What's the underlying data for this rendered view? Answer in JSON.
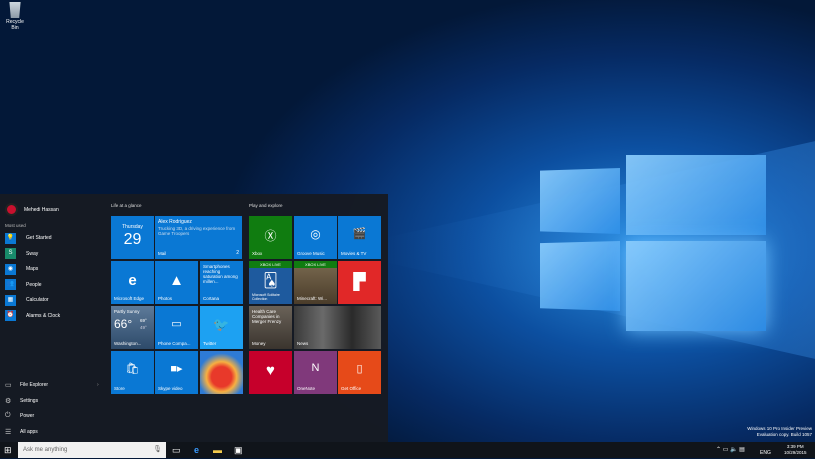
{
  "desktop": {
    "recycle_bin": "Recycle Bin",
    "watermark": [
      "Windows 10 Pro Insider Preview",
      "Evaluation copy. Build 1057"
    ]
  },
  "start": {
    "user": "Mehedi Hassan",
    "most_used_label": "Most used",
    "apps": [
      {
        "label": "Get Started",
        "icon": "lightbulb-icon",
        "color": "#0a78d4"
      },
      {
        "label": "Sway",
        "icon": "sway-icon",
        "color": "#188a6b"
      },
      {
        "label": "Maps",
        "icon": "maps-icon",
        "color": "#0a78d4"
      },
      {
        "label": "People",
        "icon": "people-icon",
        "color": "#0a78d4"
      },
      {
        "label": "Calculator",
        "icon": "calculator-icon",
        "color": "#0a78d4"
      },
      {
        "label": "Alarms & Clock",
        "icon": "alarm-icon",
        "color": "#0a78d4"
      }
    ],
    "system": [
      {
        "label": "File Explorer",
        "icon": "folder-icon"
      },
      {
        "label": "Settings",
        "icon": "gear-icon"
      },
      {
        "label": "Power",
        "icon": "power-icon"
      },
      {
        "label": "All apps",
        "icon": "list-icon"
      }
    ],
    "group1": {
      "title": "Life at a glance",
      "calendar": {
        "day": "Thursday",
        "date": "29"
      },
      "mail": {
        "from": "Alex Rodriguez",
        "body": "Trucking 3D, a driving experience from Game Troopers",
        "label": "Mail",
        "count": "2"
      },
      "edge": "Microsoft Edge",
      "photos": "Photos",
      "cortana": {
        "text": "Smartphones reaching saturation among millen...",
        "label": "Cortana"
      },
      "weather": {
        "cond": "Partly Sunny",
        "temp": "66°",
        "hi": "69°",
        "lo": "49°",
        "label": "Washington..."
      },
      "phone": "Phone Compa...",
      "twitter": "Twitter",
      "store": "Store",
      "skype": "Skype video"
    },
    "group2": {
      "title": "Play and explore",
      "xbox": "Xbox",
      "groove": "Groove Music",
      "movies": "Movies & TV",
      "xbox_live": "XBOX LIVE",
      "solitaire": "Microsoft Solitaire Collection",
      "minecraft": "Minecraft: Wi...",
      "money": {
        "headline": "Health Care Companies in Merger Frenzy",
        "label": "Money"
      },
      "news": "News",
      "onenote": "OneNote",
      "office": "Get Office"
    }
  },
  "taskbar": {
    "search_placeholder": "Ask me anything",
    "lang": "ENG",
    "time": "3:39 PM",
    "date": "10/29/2015"
  },
  "colors": {
    "accent": "#0a78d4",
    "xbox": "#107c10",
    "flipboard": "#e12828",
    "iheart": "#c6002b",
    "onenote": "#80397b",
    "office": "#e64a19"
  }
}
